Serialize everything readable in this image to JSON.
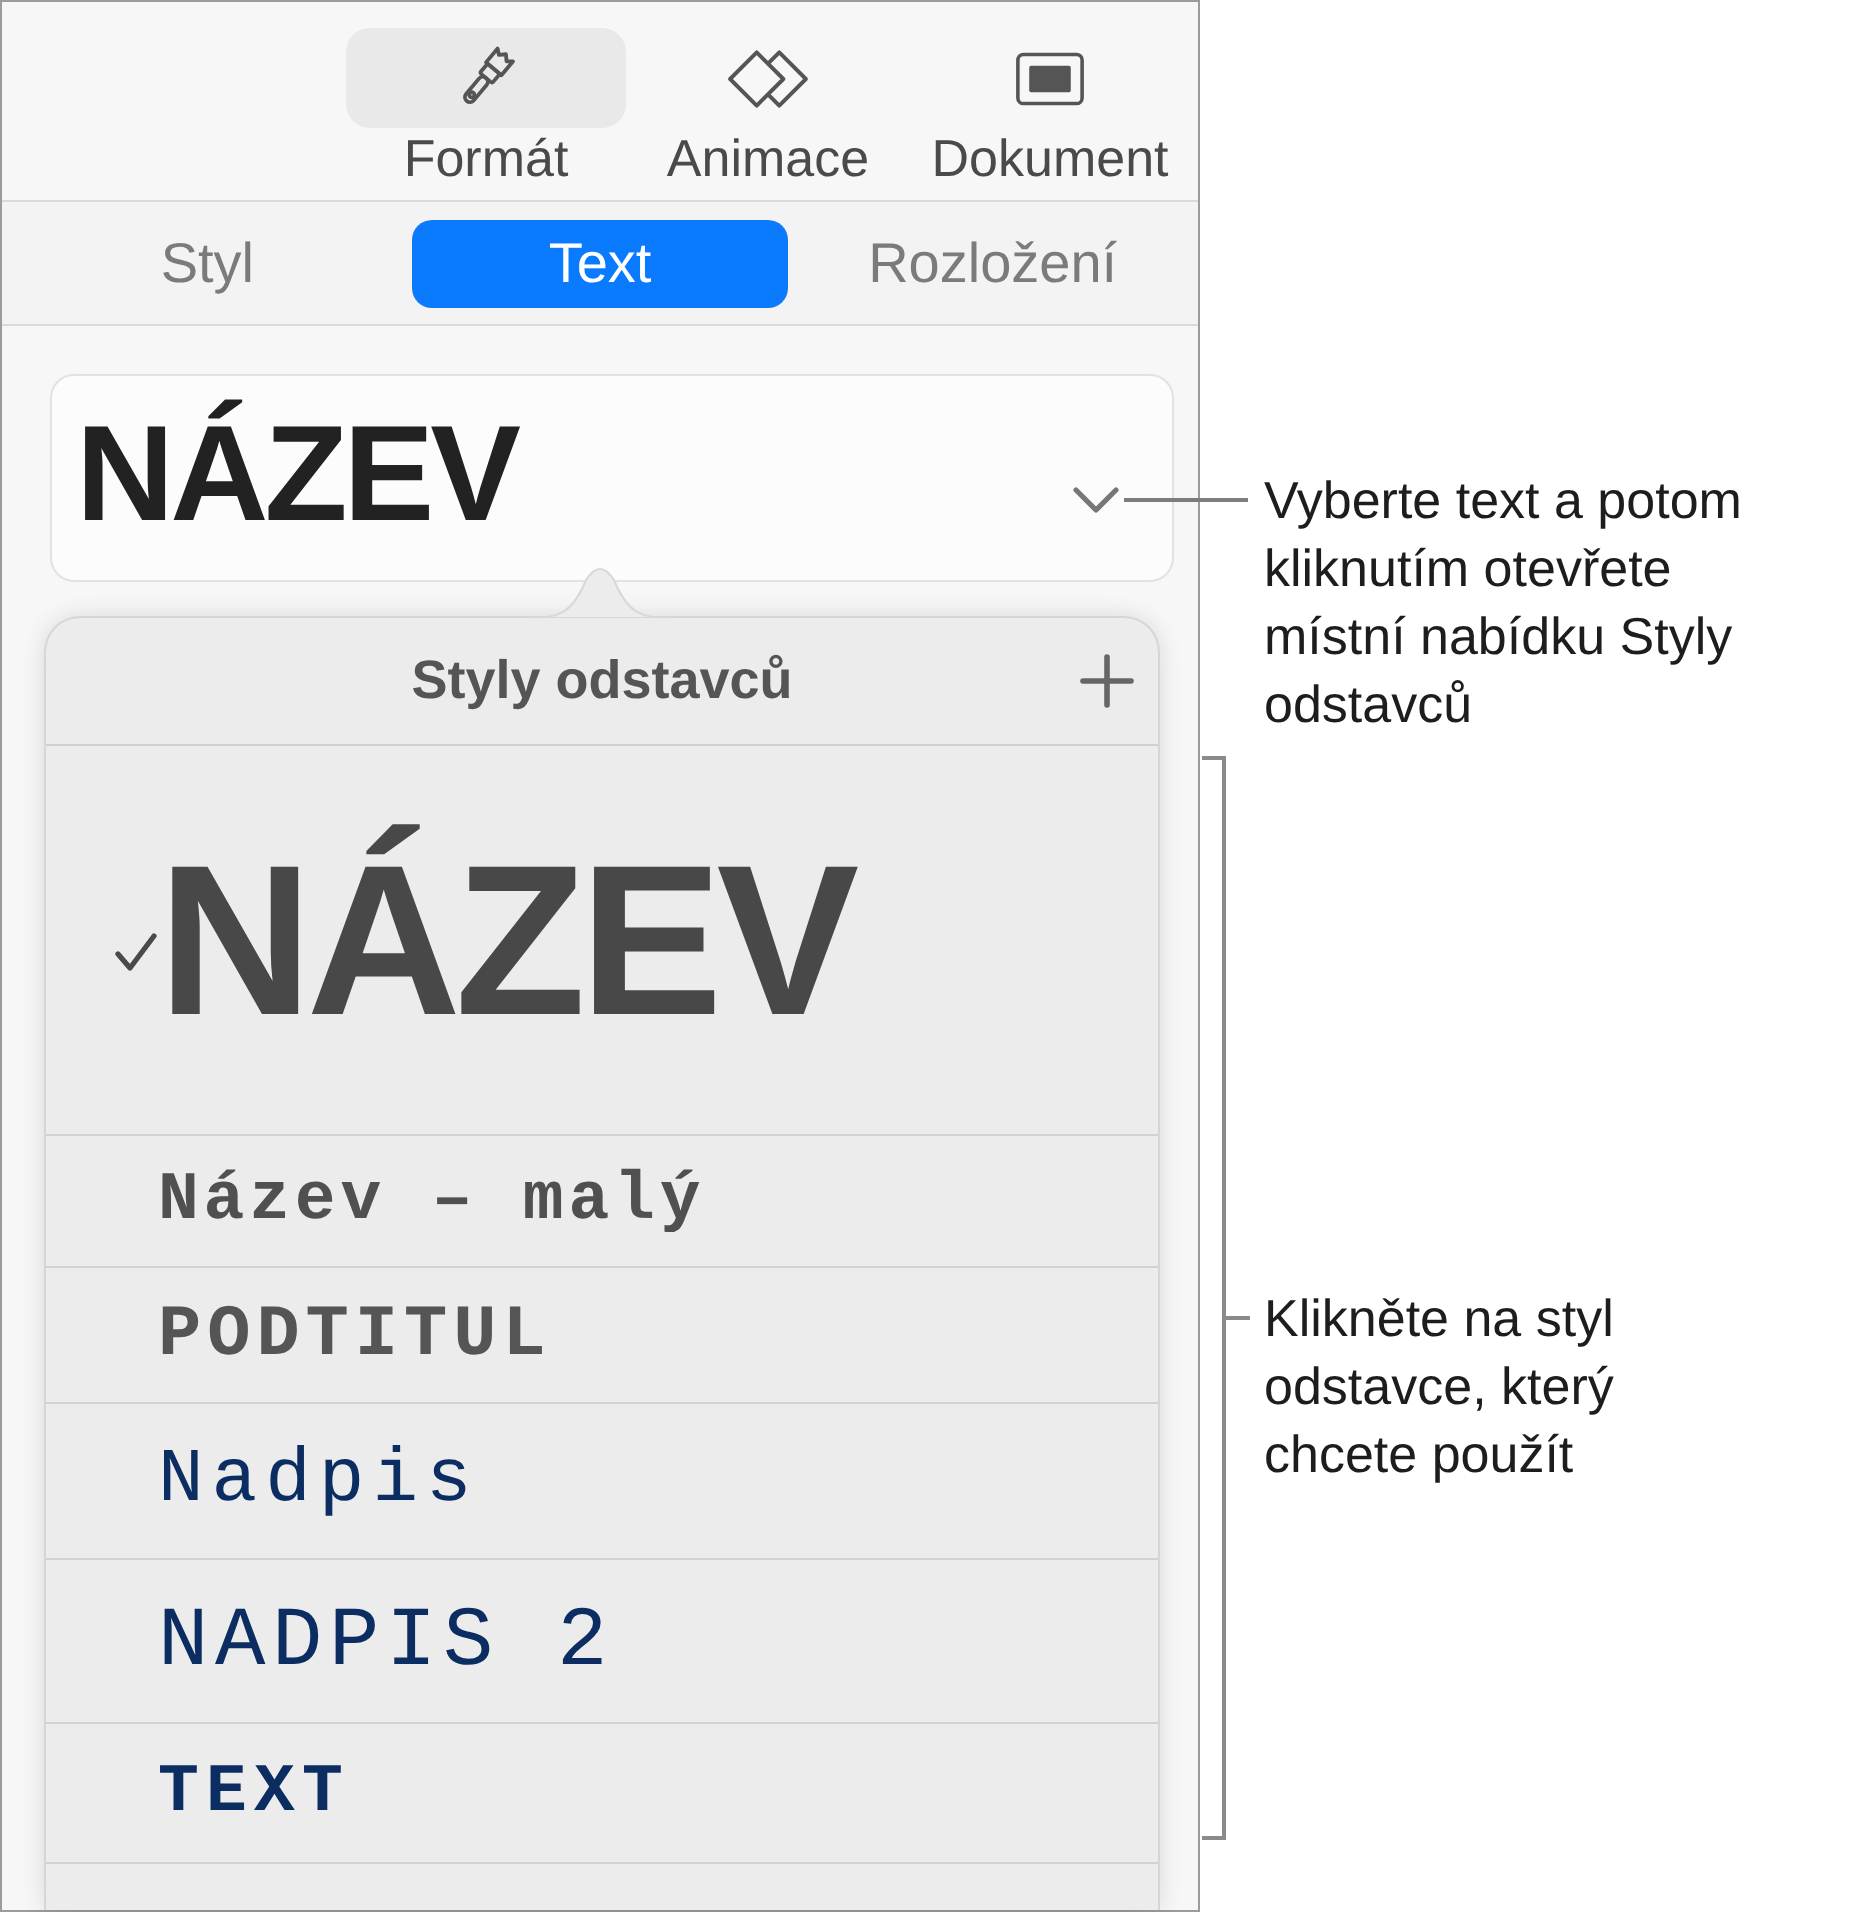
{
  "toolbar": {
    "buttons": [
      {
        "label": "Formát",
        "kind": "format",
        "selected": true
      },
      {
        "label": "Animace",
        "kind": "animate",
        "selected": false
      },
      {
        "label": "Dokument",
        "kind": "document",
        "selected": false
      }
    ]
  },
  "tabs": [
    {
      "label": "Styl",
      "selected": false
    },
    {
      "label": "Text",
      "selected": true
    },
    {
      "label": "Rozložení",
      "selected": false
    }
  ],
  "style_selector": {
    "value": "NÁZEV"
  },
  "paragraph_styles_popover": {
    "title": "Styly odstavců",
    "styles": [
      {
        "label": "NÁZEV",
        "kind": "title",
        "selected": true
      },
      {
        "label": "Název – malý",
        "kind": "title_small",
        "selected": false
      },
      {
        "label": "PODTITUL",
        "kind": "subtitle",
        "selected": false
      },
      {
        "label": "Nadpis",
        "kind": "heading",
        "selected": false
      },
      {
        "label": "NADPIS 2",
        "kind": "heading_2",
        "selected": false
      },
      {
        "label": "TEXT",
        "kind": "body",
        "selected": false
      }
    ]
  },
  "callouts": [
    "Vyberte text a potom kliknutím otevřete místní nabídku Styly odstavců",
    "Klikněte na styl odstavce, který chcete použít"
  ]
}
